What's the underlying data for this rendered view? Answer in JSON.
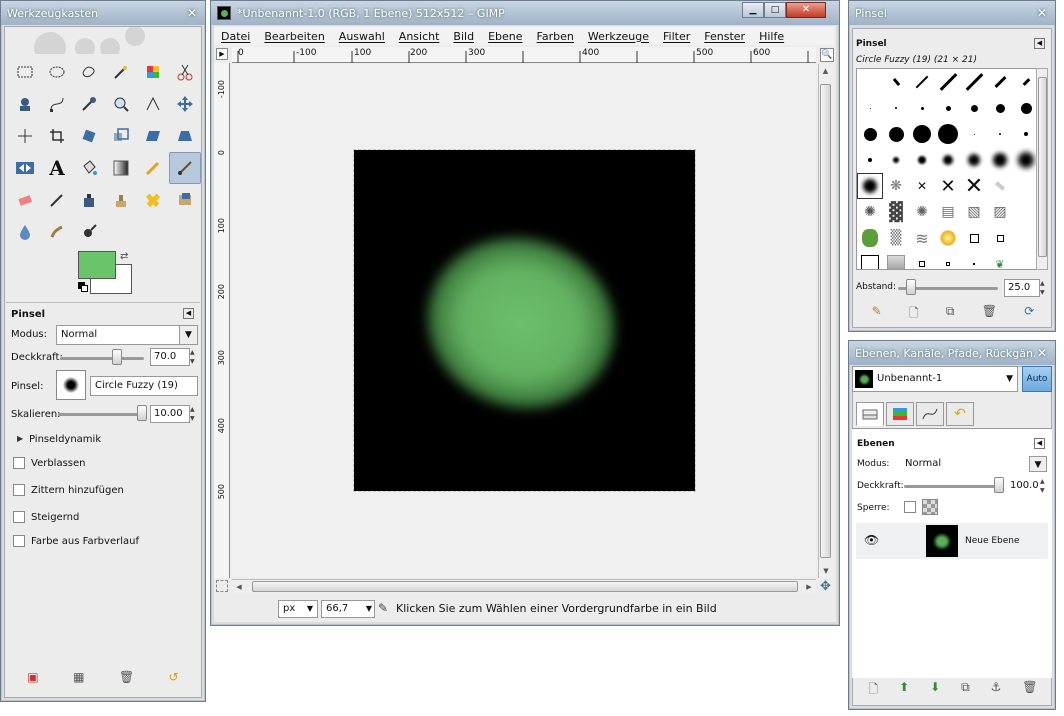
{
  "toolbox": {
    "title": "Werkzeugkasten",
    "tools": [
      "rect-select",
      "ellipse-select",
      "free-select",
      "fuzzy-select",
      "select-by-color",
      "scissors",
      "foreground-select",
      "paths",
      "color-picker",
      "zoom",
      "measure",
      "move",
      "align",
      "crop",
      "rotate",
      "scale",
      "shear",
      "perspective",
      "flip",
      "text",
      "bucket-fill",
      "blend",
      "pencil",
      "paintbrush",
      "eraser",
      "airbrush",
      "ink",
      "clone",
      "heal",
      "perspective-clone",
      "blur",
      "smudge",
      "dodge-burn"
    ],
    "fg_color": "#6ac46a",
    "bg_color": "#ffffff",
    "options": {
      "title": "Pinsel",
      "mode_label": "Modus:",
      "mode_value": "Normal",
      "opacity_label": "Deckkraft:",
      "opacity_value": "70.0",
      "brush_label": "Pinsel:",
      "brush_value": "Circle Fuzzy (19)",
      "scale_label": "Skalieren:",
      "scale_value": "10.00",
      "dynamics_label": "Pinseldynamik",
      "fade_label": "Verblassen",
      "jitter_label": "Zittern hinzufügen",
      "incremental_label": "Steigernd",
      "gradient_label": "Farbe aus Farbverlauf"
    }
  },
  "image_window": {
    "title": "*Unbenannt-1.0 (RGB, 1 Ebene) 512x512 – GIMP",
    "menu": [
      "Datei",
      "Bearbeiten",
      "Auswahl",
      "Ansicht",
      "Bild",
      "Ebene",
      "Farben",
      "Werkzeuge",
      "Filter",
      "Fenster",
      "Hilfe"
    ],
    "ruler_ticks_h": [
      "0",
      "100",
      "200",
      "300",
      "400",
      "500",
      "600"
    ],
    "ruler_ticks_v": [
      "0",
      "100",
      "200",
      "300",
      "400",
      "500"
    ],
    "ruler_ticks_h_neg": [
      "-100"
    ],
    "ruler_ticks_v_neg": [
      "-100"
    ],
    "unit": "px",
    "zoom": "66,7",
    "status": "Klicken Sie zum Wählen einer Vordergrundfarbe in ein Bild"
  },
  "brushes": {
    "title": "Pinsel",
    "panel_title": "Pinsel",
    "selected": "Circle Fuzzy (19) (21 × 21)",
    "spacing_label": "Abstand:",
    "spacing_value": "25.0"
  },
  "layers": {
    "title": "Ebenen, Kanäle, Pfade, Rückgän...",
    "image_name": "Unbenannt-1",
    "auto_label": "Auto",
    "panel_title": "Ebenen",
    "mode_label": "Modus:",
    "mode_value": "Normal",
    "opacity_label": "Deckkraft:",
    "opacity_value": "100.0",
    "lock_label": "Sperre:",
    "layer_name": "Neue Ebene"
  }
}
